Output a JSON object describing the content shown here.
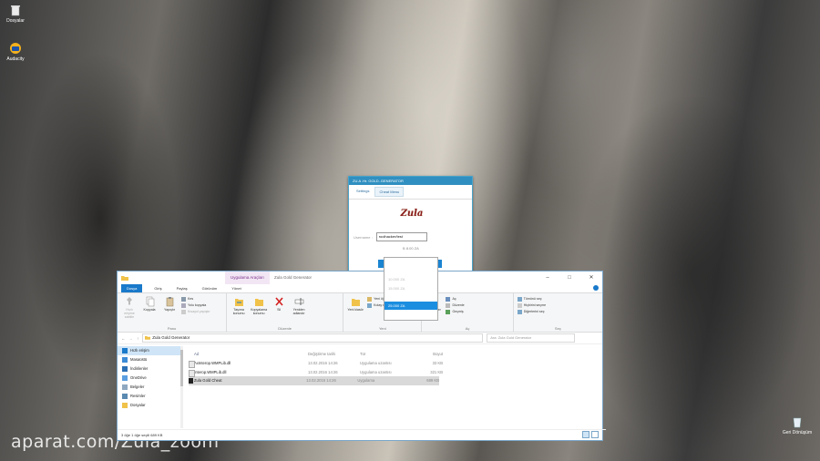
{
  "desktop": {
    "icons": [
      {
        "label": "Dosyalar",
        "icon": "trash-icon"
      },
      {
        "label": "Audacity",
        "icon": "audacity-icon"
      },
      {
        "label": "Geri Dönüşüm",
        "icon": "recycle-bin-icon"
      }
    ],
    "watermark": "aparat.com/Zula_zoom"
  },
  "zula_dialog": {
    "title": "ZU.A .Hr. GOLD..GENERATOR",
    "tabs": [
      "Settings",
      "Cheat Menu"
    ],
    "logo": "Zula",
    "username_label": "Username :",
    "username_value": "roolhacker/test",
    "selected_amount": "₺ 8.00 ZA",
    "dropdown_items": [
      "",
      "",
      "10.000 ZA",
      "15.000 ZA",
      "",
      "25.000 ZA"
    ]
  },
  "explorer": {
    "context_tab": "Uygulama Araçları",
    "window_title": "Zula Gold Generator",
    "menu": [
      "Dosya",
      "Giriş",
      "Paylaş",
      "Görünüm",
      "Yönet"
    ],
    "ribbon": {
      "clipboard": {
        "pin_label": "Hızlı erişime sabitle",
        "copy_label": "Kopyala",
        "paste_label": "Yapıştır",
        "cut_label": "Kes",
        "copy_path_label": "Yolu kopyala",
        "paste_shortcut_label": "Kısayol yapıştır",
        "group": "Pano"
      },
      "organize": {
        "move_label": "Taşıma konumu",
        "copy_to_label": "Kopyalama konumu",
        "delete_label": "Sil",
        "rename_label": "Yeniden adlandır",
        "group": "Düzenle"
      },
      "new": {
        "new_folder_label": "Yeni klasör",
        "new_item_label": "Yeni öğe",
        "easy_access_label": "Kolay erişim",
        "group": "Yeni"
      },
      "open": {
        "properties_label": "Özellikler",
        "open_label": "Aç",
        "edit_label": "Düzenle",
        "history_label": "Geçmiş",
        "group": "Aç"
      },
      "select": {
        "select_all_label": "Tümünü seç",
        "select_none_label": "Hiçbirini seçme",
        "invert_label": "Diğerlerini seç",
        "group": "Seç"
      }
    },
    "address": {
      "path": "Zula Gold Generator",
      "search_placeholder": "Ara: Zula Gold Generator"
    },
    "nav": [
      {
        "label": "Hızlı erişim",
        "icon": "star-icon"
      },
      {
        "label": "Masaüstü",
        "icon": "desktop-icon"
      },
      {
        "label": "İndirilenler",
        "icon": "download-icon"
      },
      {
        "label": "OneDrive",
        "icon": "cloud-icon"
      },
      {
        "label": "Belgeler",
        "icon": "documents-icon"
      },
      {
        "label": "Resimler",
        "icon": "pictures-icon"
      },
      {
        "label": "Dosyalar",
        "icon": "folder-icon"
      }
    ],
    "columns": [
      "Ad",
      "Değiştirme tarihi",
      "Tür",
      "Boyut"
    ],
    "files": [
      {
        "name": "AxInterop.WMPLib.dll",
        "date": "13.02.2016 14:26",
        "type": "Uygulama uzantısı",
        "size": "33 KB"
      },
      {
        "name": "Interop.WMPLib.dll",
        "date": "13.02.2016 14:26",
        "type": "Uygulama uzantısı",
        "size": "321 KB"
      },
      {
        "name": "Zula Gold Cheat",
        "date": "13.02.2016 14:26",
        "type": "Uygulama",
        "size": "689 KB"
      }
    ],
    "status": "3 öğe   1 öğe seçili  689 KB"
  }
}
